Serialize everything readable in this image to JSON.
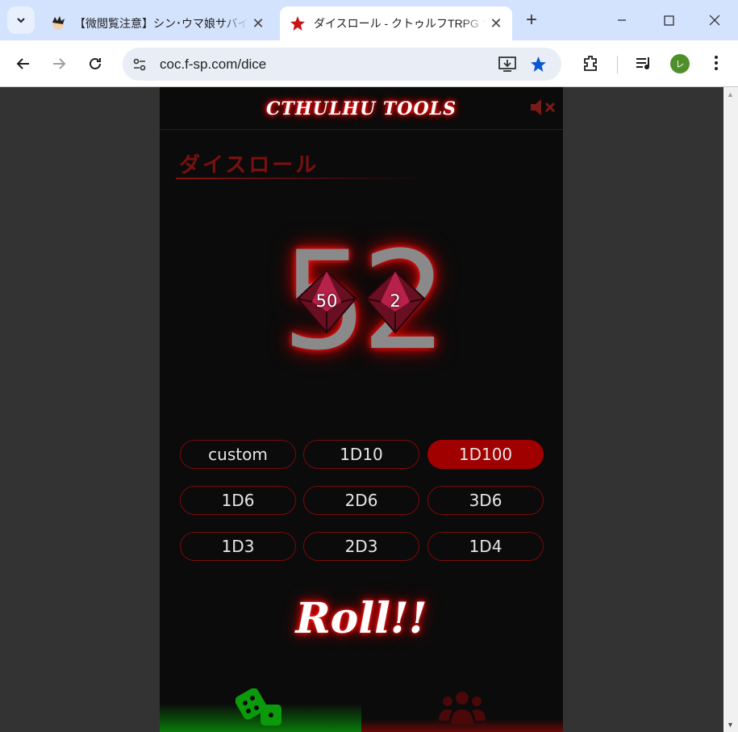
{
  "browser": {
    "tabs": [
      {
        "title": "【微閲覧注意】シン･ウマ娘サバイバ"
      },
      {
        "title": "ダイスロール - クトゥルフTRPG ツー"
      }
    ],
    "url": "coc.f-sp.com/dice",
    "profile_initial": "レ"
  },
  "app": {
    "logo": "CTHULHU TOOLS",
    "page_title": "ダイスロール",
    "result": "52",
    "dice": [
      {
        "label": "50"
      },
      {
        "label": "2"
      }
    ],
    "buttons": [
      {
        "label": "custom",
        "active": false
      },
      {
        "label": "1D10",
        "active": false
      },
      {
        "label": "1D100",
        "active": true
      },
      {
        "label": "1D6",
        "active": false
      },
      {
        "label": "2D6",
        "active": false
      },
      {
        "label": "3D6",
        "active": false
      },
      {
        "label": "1D3",
        "active": false
      },
      {
        "label": "2D3",
        "active": false
      },
      {
        "label": "1D4",
        "active": false
      }
    ],
    "roll_label": "Roll!!"
  },
  "colors": {
    "accent_red": "#a00000",
    "tab_strip": "#d3e3fd",
    "nav_dice_active": "#0a7a0a"
  }
}
